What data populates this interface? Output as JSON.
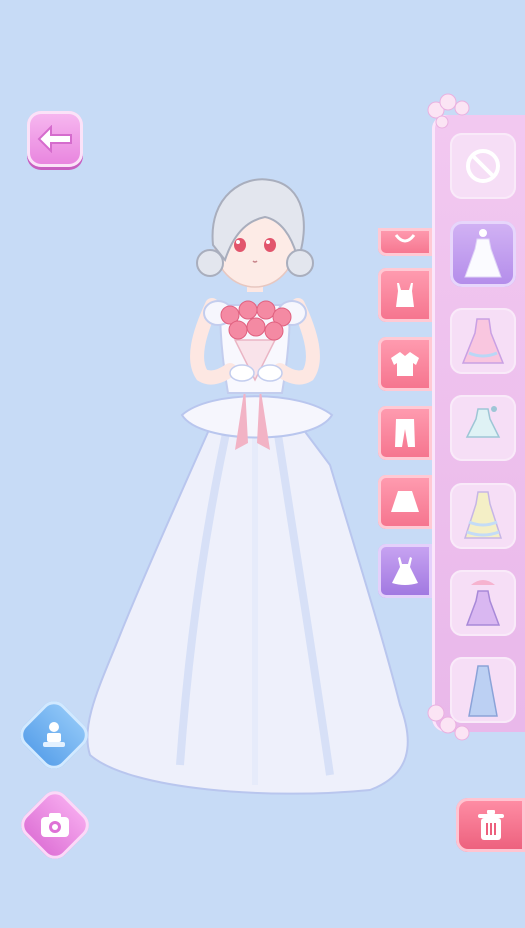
{
  "screen": {
    "background": "#c7dbf6"
  },
  "toolbar": {
    "back_icon": "arrow-left-icon",
    "pose_icon": "pose-stand-icon",
    "camera_icon": "camera-icon",
    "trash_icon": "trash-icon"
  },
  "categories": [
    {
      "name": "accessory",
      "icon": "accessory-icon",
      "active": false
    },
    {
      "name": "top-camisole",
      "icon": "camisole-icon",
      "active": false
    },
    {
      "name": "top-shirt",
      "icon": "shirt-icon",
      "active": false
    },
    {
      "name": "pants",
      "icon": "pants-icon",
      "active": false
    },
    {
      "name": "skirt",
      "icon": "skirt-icon",
      "active": false
    },
    {
      "name": "dress",
      "icon": "dress-icon",
      "active": true
    }
  ],
  "items": [
    {
      "name": "none",
      "icon": "no-item-icon",
      "selected": false
    },
    {
      "name": "white-wedding-gown",
      "icon": "wedding-gown-icon",
      "selected": true
    },
    {
      "name": "pink-ball-gown",
      "icon": "pink-gown-icon",
      "selected": false
    },
    {
      "name": "mint-short-dress",
      "icon": "short-dress-icon",
      "selected": false
    },
    {
      "name": "pastel-tiered-gown",
      "icon": "tiered-gown-icon",
      "selected": false
    },
    {
      "name": "purple-parasol-gown",
      "icon": "parasol-gown-icon",
      "selected": false
    },
    {
      "name": "blue-long-gown",
      "icon": "blue-gown-icon",
      "selected": false
    }
  ],
  "colors": {
    "accent_pink": "#f5738d",
    "accent_purple": "#9f76e0",
    "panel": "#ecbdec"
  }
}
